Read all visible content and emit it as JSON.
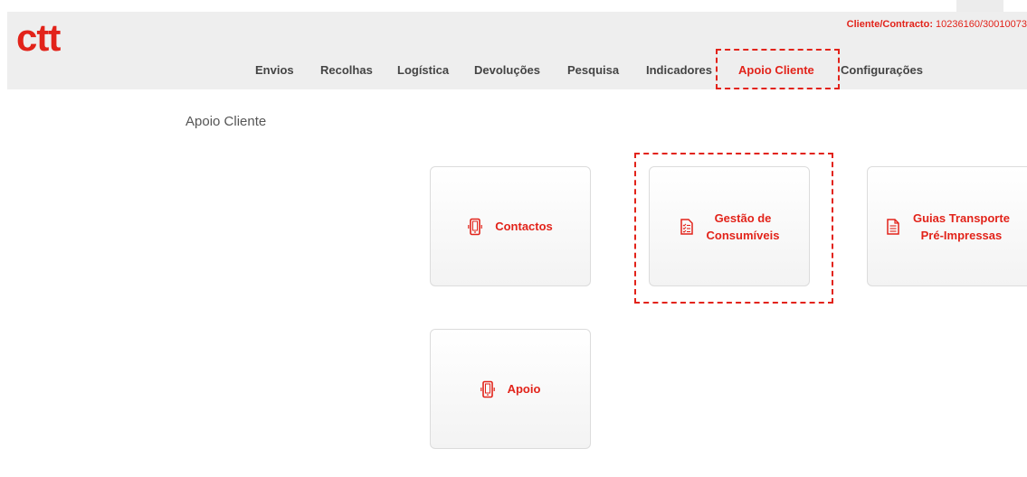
{
  "brand": {
    "logo_text": "ctt",
    "accent": "#e2231a"
  },
  "client": {
    "label": "Cliente/Contracto:",
    "value": "10236160/30010073"
  },
  "nav": {
    "envios": "Envios",
    "recolhas": "Recolhas",
    "logistica": "Logística",
    "devolucoes": "Devoluções",
    "pesquisa": "Pesquisa",
    "indicadores": "Indicadores",
    "apoio_cliente": "Apoio Cliente",
    "configuracoes": "Configurações",
    "active": "Apoio Cliente"
  },
  "page": {
    "title": "Apoio Cliente"
  },
  "cards": {
    "contactos": {
      "line1": "Contactos",
      "line2": "",
      "icon": "mobile-phone-icon"
    },
    "gestao": {
      "line1": "Gestão de",
      "line2": "Consumíveis",
      "icon": "checklist-icon"
    },
    "guias": {
      "line1": "Guias Transporte",
      "line2": "Pré-Impressas",
      "icon": "document-icon"
    },
    "apoio": {
      "line1": "Apoio",
      "line2": "",
      "icon": "mobile-phone-icon"
    }
  }
}
